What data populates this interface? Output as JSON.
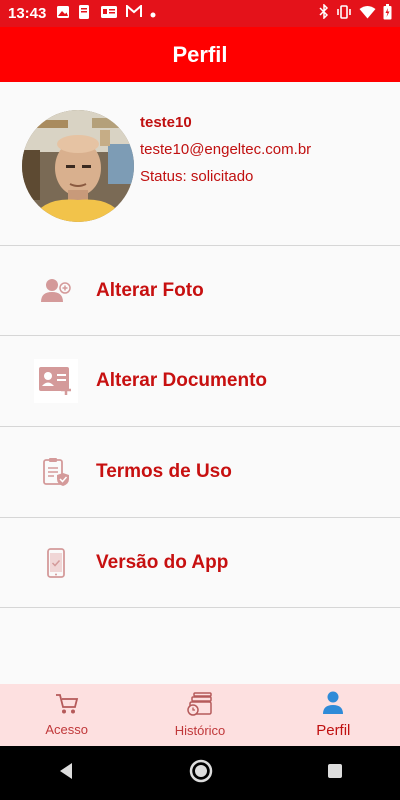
{
  "status_bar": {
    "time": "13:43",
    "left_icons": [
      "gallery-icon",
      "document-icon",
      "id-card-icon",
      "gmail-icon",
      "dot-icon"
    ],
    "right_icons": [
      "bluetooth-icon",
      "vibrate-icon",
      "wifi-icon",
      "battery-icon"
    ]
  },
  "header": {
    "title": "Perfil"
  },
  "profile": {
    "name": "teste10",
    "email": "teste10@engeltec.com.br",
    "status": "Status: solicitado"
  },
  "menu": [
    {
      "label": "Alterar Foto",
      "icon": "add-user-icon"
    },
    {
      "label": "Alterar Documento",
      "icon": "id-card-add-icon"
    },
    {
      "label": "Termos de Uso",
      "icon": "clipboard-check-icon"
    },
    {
      "label": "Versão do App",
      "icon": "phone-check-icon"
    }
  ],
  "bottom_nav": [
    {
      "label": "Acesso",
      "icon": "cart-icon",
      "active": false
    },
    {
      "label": "Histórico",
      "icon": "history-cards-icon",
      "active": false
    },
    {
      "label": "Perfil",
      "icon": "person-icon",
      "active": true
    }
  ],
  "colors": {
    "app_bar": "#ff0000",
    "status_bar": "#e4121a",
    "accent_text": "#c71010",
    "icon_tint": "#d49a9a",
    "bottom_nav_bg": "#fde0e0",
    "active_nav_icon": "#2f8bd8"
  }
}
